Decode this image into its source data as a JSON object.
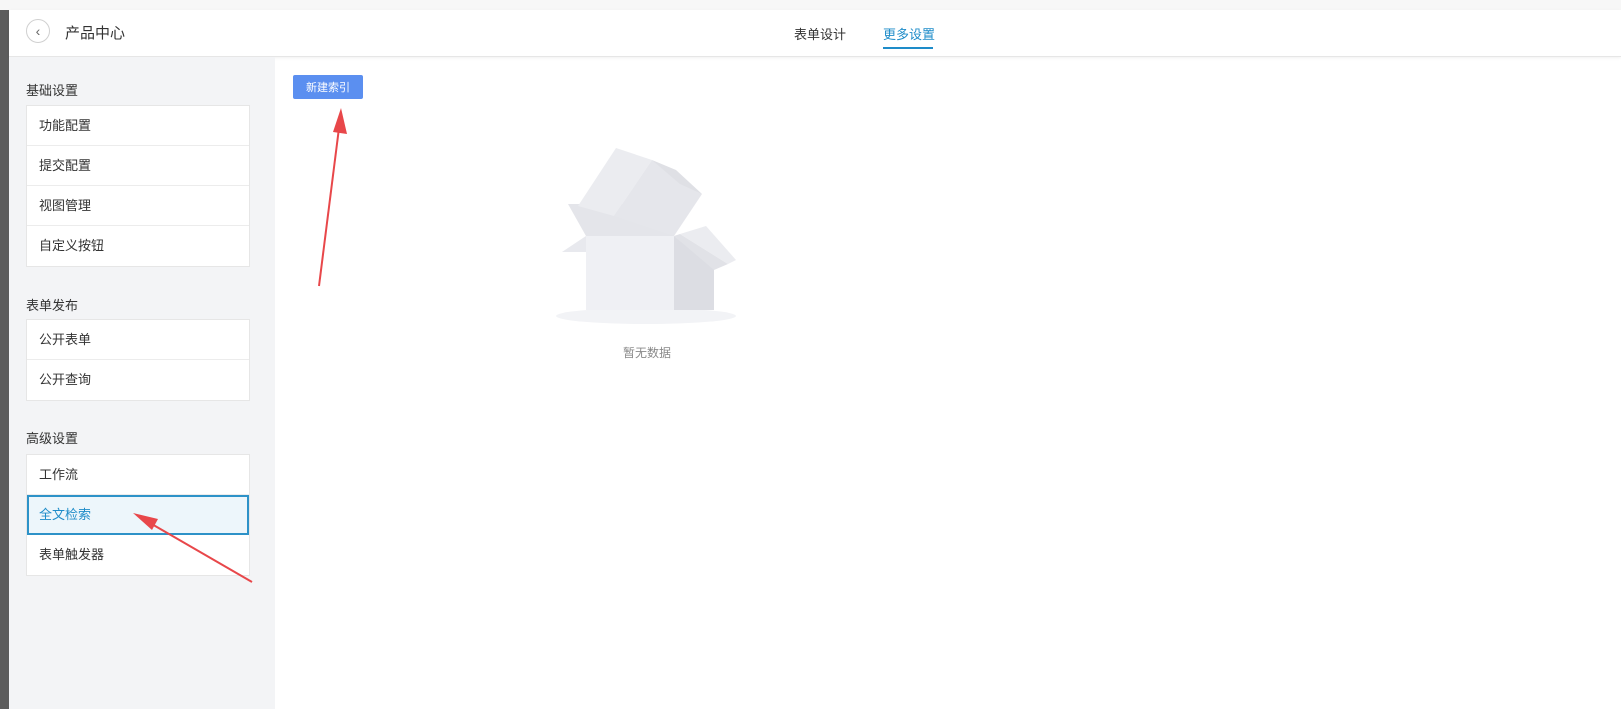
{
  "header": {
    "title": "产品中心",
    "tabs": [
      {
        "label": "表单设计",
        "active": false
      },
      {
        "label": "更多设置",
        "active": true
      }
    ]
  },
  "sidebar": {
    "groups": [
      {
        "title": "基础设置",
        "items": [
          "功能配置",
          "提交配置",
          "视图管理",
          "自定义按钮"
        ]
      },
      {
        "title": "表单发布",
        "items": [
          "公开表单",
          "公开查询"
        ]
      },
      {
        "title": "高级设置",
        "items": [
          "工作流",
          "全文检索",
          "表单触发器"
        ]
      }
    ],
    "active_item": "全文检索"
  },
  "main": {
    "new_index_button": "新建索引",
    "empty_text": "暂无数据"
  },
  "icons": {
    "back": "chevron-left-icon",
    "empty": "empty-box-illustration",
    "annotation": "red-arrow"
  },
  "colors": {
    "accent": "#1e8cc9",
    "button": "#5b8ff0",
    "annotation_arrow": "#e8474a",
    "sidebar_bg": "#f3f4f6"
  }
}
